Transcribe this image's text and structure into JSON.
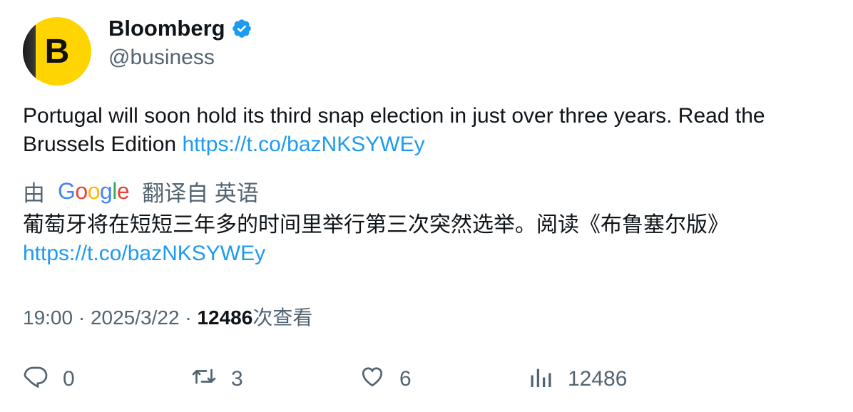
{
  "author": {
    "name": "Bloomberg",
    "handle": "@business",
    "avatar_letter": "B",
    "verified": true,
    "avatar_color": "#ffd400"
  },
  "tweet": {
    "text": "Portugal will soon hold its third snap election in just over three years. Read the Brussels Edition",
    "link": "https://t.co/bazNKSYWEy"
  },
  "translation": {
    "prefix": "由",
    "provider": "Google",
    "suffix": "翻译自 英语",
    "text": "葡萄牙将在短短三年多的时间里举行第三次突然选举。阅读《布鲁塞尔版》",
    "link": "https://t.co/bazNKSYWEy"
  },
  "meta": {
    "time": "19:00",
    "separator": "·",
    "date": "2025/3/22",
    "views": "12486",
    "views_label": "次查看"
  },
  "actions": {
    "replies": "0",
    "retweets": "3",
    "likes": "6",
    "views": "12486"
  },
  "colors": {
    "link": "#1d9bf0",
    "secondary_text": "#536471",
    "verified": "#1d9bf0"
  }
}
